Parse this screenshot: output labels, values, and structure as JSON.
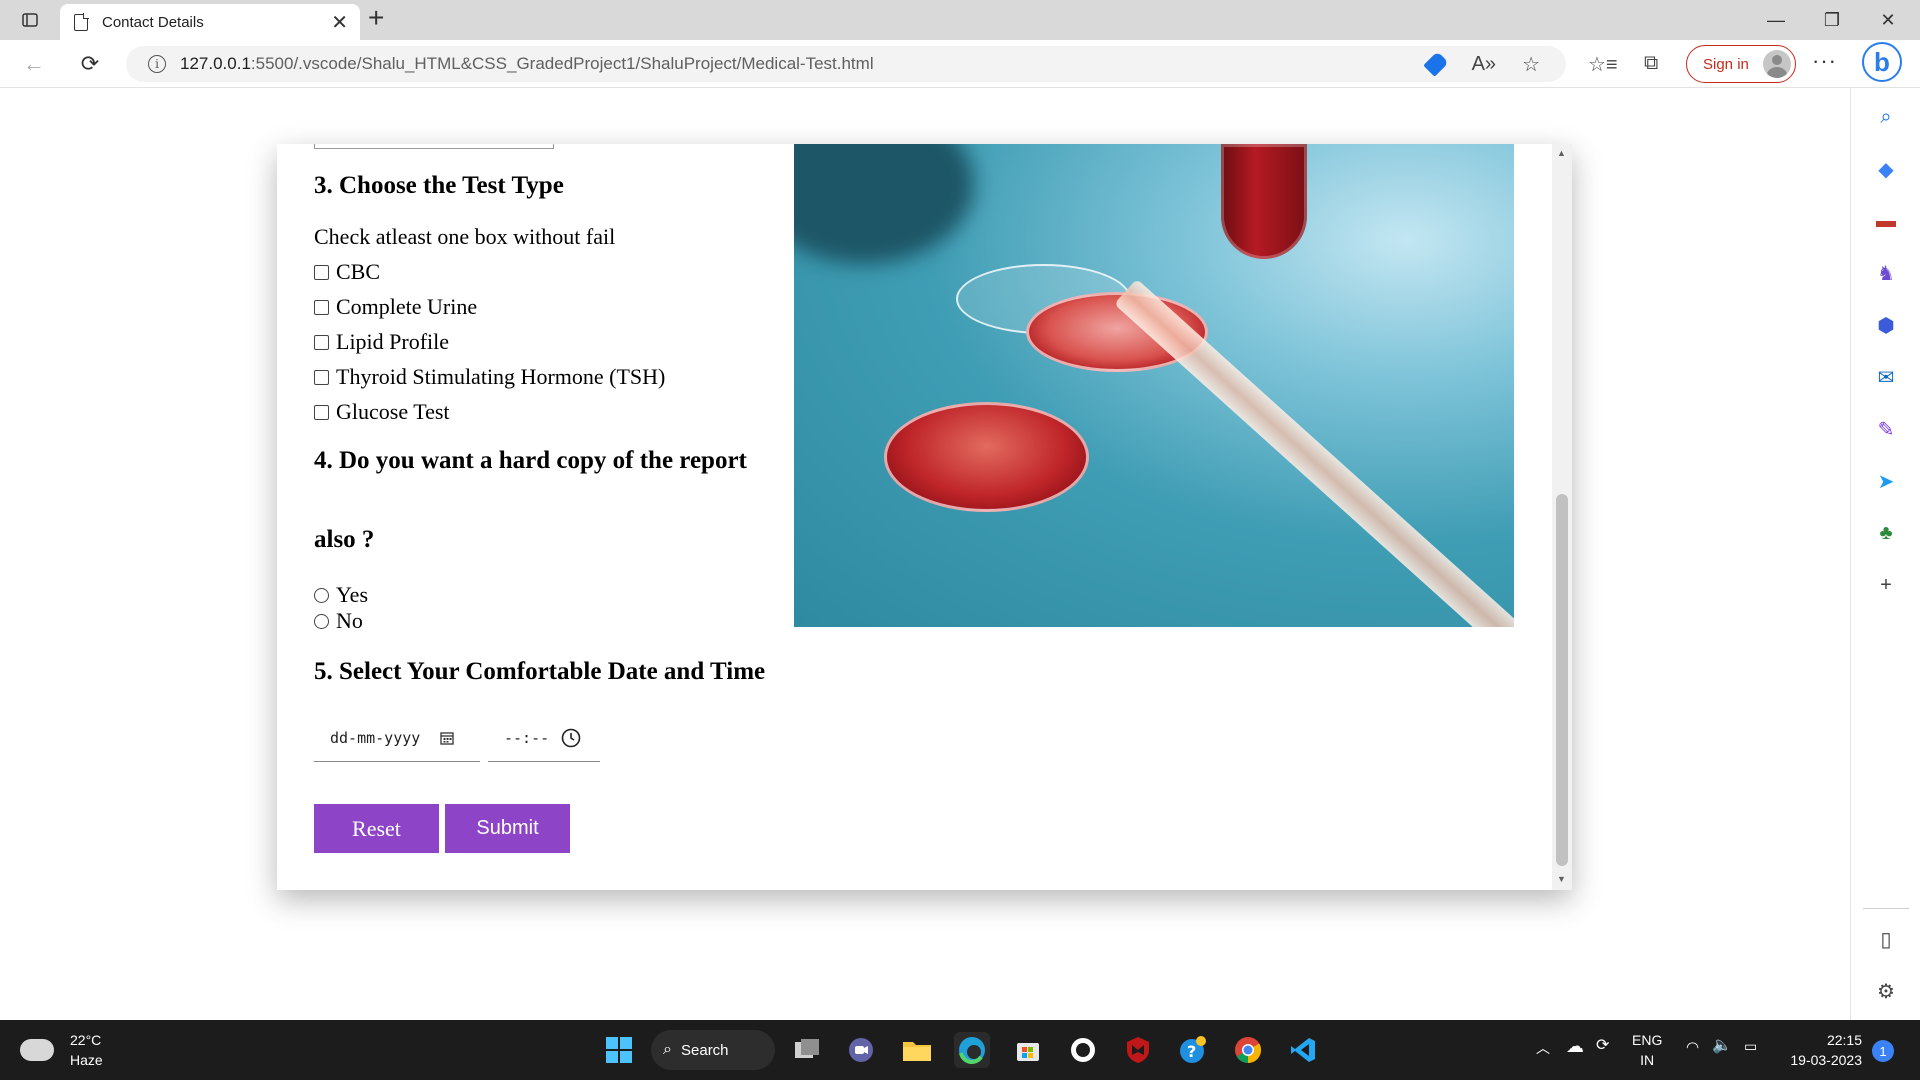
{
  "browser": {
    "tab_title": "Contact Details",
    "url_host": "127.0.0.1",
    "url_path": ":5500/.vscode/Shalu_HTML&CSS_GradedProject1/ShaluProject/Medical-Test.html",
    "sign_in_label": "Sign in"
  },
  "form": {
    "section3_title": "3. Choose the Test Type",
    "section3_hint": "Check atleast one box without fail",
    "tests": [
      "CBC",
      "Complete Urine",
      "Lipid Profile",
      "Thyroid Stimulating Hormone (TSH)",
      "Glucose Test"
    ],
    "section4_title_line1": "4. Do you want a hard copy of the report",
    "section4_title_line2": "also ?",
    "hardcopy_options": [
      "Yes",
      "No"
    ],
    "section5_title": "5. Select Your Comfortable Date and Time",
    "date_placeholder": "dd-mm-yyyy",
    "time_placeholder": "--:--",
    "reset_label": "Reset",
    "submit_label": "Submit",
    "button_color": "#8e44c6"
  },
  "taskbar": {
    "temperature": "22°C",
    "weather": "Haze",
    "search_label": "Search",
    "lang_line1": "ENG",
    "lang_line2": "IN",
    "time": "22:15",
    "date": "19-03-2023",
    "notification_count": "1"
  }
}
